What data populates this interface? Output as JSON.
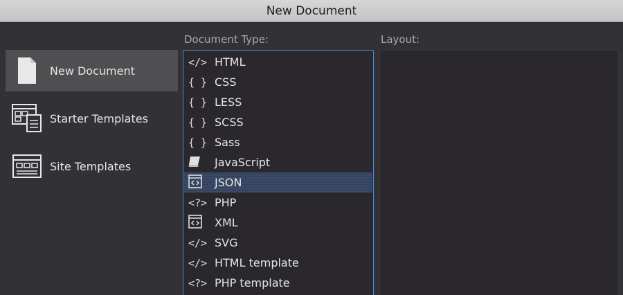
{
  "window": {
    "title": "New Document"
  },
  "sidebar": {
    "items": [
      {
        "label": "New Document",
        "icon": "document-icon",
        "active": true
      },
      {
        "label": "Starter Templates",
        "icon": "starter-templates-icon",
        "active": false
      },
      {
        "label": "Site Templates",
        "icon": "site-templates-icon",
        "active": false
      }
    ]
  },
  "document_type": {
    "label": "Document Type:",
    "items": [
      {
        "label": "HTML",
        "glyph": "</>",
        "icon": "code-tag-icon"
      },
      {
        "label": "CSS",
        "glyph": "{ }",
        "icon": "curly-braces-icon"
      },
      {
        "label": "LESS",
        "glyph": "{ }",
        "icon": "curly-braces-icon"
      },
      {
        "label": "SCSS",
        "glyph": "{ }",
        "icon": "curly-braces-icon"
      },
      {
        "label": "Sass",
        "glyph": "{ }",
        "icon": "curly-braces-icon"
      },
      {
        "label": "JavaScript",
        "glyph": "",
        "icon": "scroll-icon"
      },
      {
        "label": "JSON",
        "glyph": "",
        "icon": "json-box-icon",
        "selected": true
      },
      {
        "label": "PHP",
        "glyph": "<?>",
        "icon": "php-tag-icon"
      },
      {
        "label": "XML",
        "glyph": "",
        "icon": "xml-box-icon"
      },
      {
        "label": "SVG",
        "glyph": "</>",
        "icon": "code-tag-icon"
      },
      {
        "label": "HTML template",
        "glyph": "</>",
        "icon": "code-tag-icon"
      },
      {
        "label": "PHP template",
        "glyph": "<?>",
        "icon": "php-tag-icon"
      }
    ]
  },
  "layout": {
    "label": "Layout:"
  },
  "colors": {
    "selection": "#3b4a66",
    "focus_border": "#4a8fdc",
    "active_sidebar": "#4f4f52"
  }
}
